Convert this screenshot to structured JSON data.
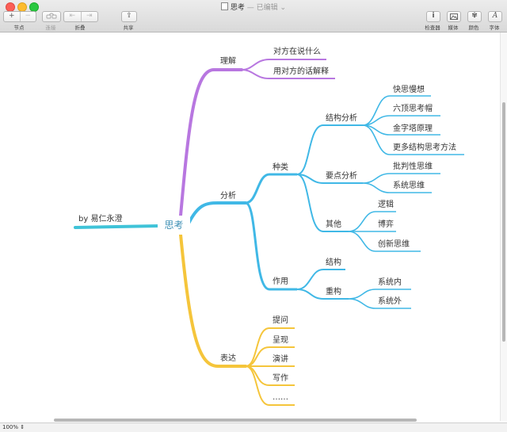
{
  "window": {
    "title": "思考",
    "subtitle": "— 已编辑",
    "zoom": "100%"
  },
  "toolbar": {
    "node_label": "节点",
    "connect_label": "连接",
    "fold_label": "折叠",
    "share_label": "共享",
    "inspector_label": "检查器",
    "media_label": "媒体",
    "color_label": "颜色",
    "font_label": "字体",
    "add_symbol": "+",
    "remove_symbol": "−",
    "share_symbol": "⇪",
    "inspector_symbol": "i",
    "color_symbol": "✾",
    "font_symbol": "A"
  },
  "colors": {
    "purple": "#b877e0",
    "blue": "#40b8e6",
    "yellow": "#f5c53b",
    "root_line": "#3fc3d8"
  },
  "mindmap": {
    "root": "思考",
    "author": "by 易仁永澄",
    "branches": {
      "understand": {
        "label": "理解",
        "children": [
          "对方在说什么",
          "用对方的话解释"
        ]
      },
      "analyze": {
        "label": "分析",
        "types": {
          "label": "种类",
          "structural": {
            "label": "结构分析",
            "children": [
              "快思慢想",
              "六顶思考帽",
              "金字塔原理",
              "更多结构思考方法"
            ]
          },
          "key_points": {
            "label": "要点分析",
            "children": [
              "批判性思维",
              "系统思维"
            ]
          },
          "others": {
            "label": "其他",
            "children": [
              "逻辑",
              "博弈",
              "创新思维"
            ]
          }
        },
        "functions": {
          "label": "作用",
          "structure": "结构",
          "restructure": {
            "label": "重构",
            "children": [
              "系统内",
              "系统外"
            ]
          }
        }
      },
      "express": {
        "label": "表达",
        "children": [
          "提问",
          "呈现",
          "演讲",
          "写作",
          "……"
        ]
      }
    }
  }
}
